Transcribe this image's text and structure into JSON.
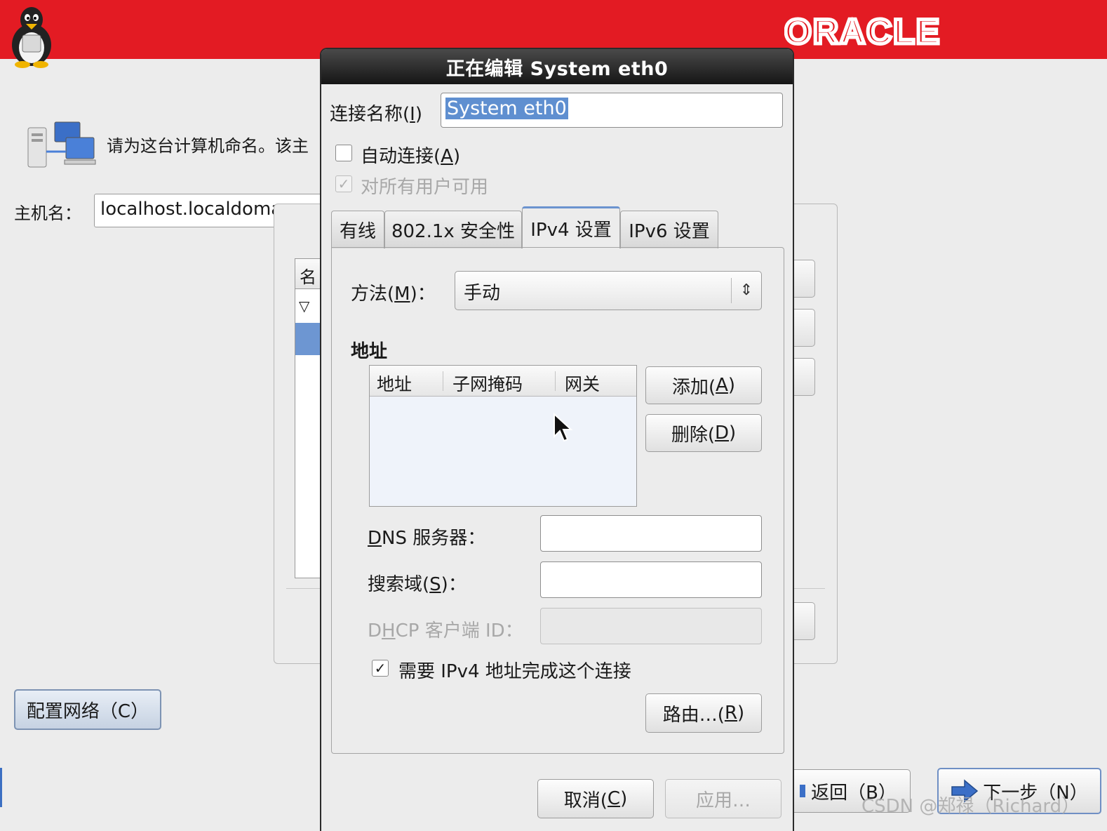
{
  "header": {
    "brand": "ORACLE",
    "brand_color": "#e31b23"
  },
  "hostname_page": {
    "prompt": "请为这台计算机命名。该主",
    "hostname_label": "主机名：",
    "hostname_value": "localhost.localdoma",
    "network_list_header": "名",
    "configure_network_button": "配置网络（C）"
  },
  "nav": {
    "back": "返回（B）",
    "next": "下一步（N）"
  },
  "watermark": "CSDN @郑禄（Richard）",
  "dialog": {
    "title": "正在编辑 System eth0",
    "connection_name_label": "连接名称(I)",
    "connection_name_value": "System eth0",
    "auto_connect_label": "自动连接(A)",
    "auto_connect_checked": false,
    "all_users_label": "对所有用户可用",
    "all_users_checked": true,
    "tabs": [
      {
        "label": "有线",
        "active": false
      },
      {
        "label": "802.1x 安全性",
        "active": false
      },
      {
        "label": "IPv4 设置",
        "active": true
      },
      {
        "label": "IPv6 设置",
        "active": false
      }
    ],
    "ipv4": {
      "method_label": "方法(M)：",
      "method_value": "手动",
      "address_section_title": "地址",
      "address_columns": [
        "地址",
        "子网掩码",
        "网关"
      ],
      "address_rows": [],
      "add_button": "添加(A)",
      "delete_button": "删除(D)",
      "dns_label": "DNS 服务器：",
      "dns_value": "",
      "search_domain_label": "搜索域(S)：",
      "search_domain_value": "",
      "dhcp_client_id_label": "DHCP 客户端 ID：",
      "dhcp_client_id_value": "",
      "require_ipv4_label": "需要 IPv4 地址完成这个连接",
      "require_ipv4_checked": true,
      "routes_button": "路由…(R)"
    },
    "cancel_button": "取消(C)",
    "apply_button": "应用…"
  }
}
